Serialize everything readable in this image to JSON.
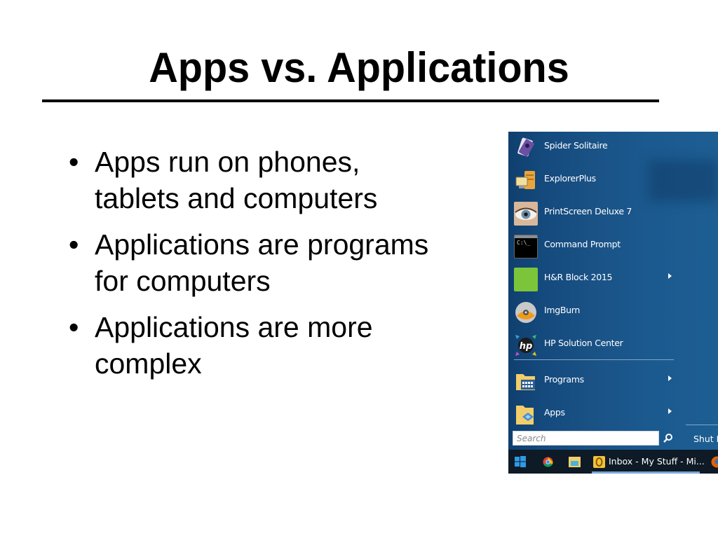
{
  "slide": {
    "title": "Apps vs. Applications",
    "bullet_glyph": "•",
    "bullets": [
      {
        "line1": "Apps run on phones,",
        "line2": "tablets and computers"
      },
      {
        "line1": "Applications are programs",
        "line2": "for computers"
      },
      {
        "line1": "Applications are more",
        "line2": "complex"
      }
    ]
  },
  "start_menu": {
    "items": [
      {
        "label": "Spider Solitaire",
        "icon": "spider-solitaire-icon",
        "submenu": false
      },
      {
        "label": "ExplorerPlus",
        "icon": "explorerplus-icon",
        "submenu": false
      },
      {
        "label": "PrintScreen Deluxe 7",
        "icon": "eye-icon",
        "submenu": false
      },
      {
        "label": "Command Prompt",
        "icon": "command-prompt-icon",
        "submenu": false
      },
      {
        "label": "H&R Block 2015",
        "icon": "hr-block-icon",
        "submenu": true
      },
      {
        "label": "ImgBurn",
        "icon": "imgburn-disc-icon",
        "submenu": false
      },
      {
        "label": "HP Solution Center",
        "icon": "hp-logo-icon",
        "submenu": false
      }
    ],
    "bottom_items": [
      {
        "label": "Programs",
        "icon": "programs-folder-icon",
        "submenu": true
      },
      {
        "label": "Apps",
        "icon": "apps-folder-icon",
        "submenu": true
      }
    ],
    "search_placeholder": "Search",
    "shutdown_label": "Shut D",
    "cmd_icon_text": "C:\\_"
  },
  "taskbar": {
    "window_label": "Inbox - My Stuff - Mi...",
    "buttons": [
      "windows-start-icon",
      "chrome-icon",
      "file-explorer-icon",
      "outlook-icon",
      "firefox-icon"
    ]
  },
  "colors": {
    "menu_bg": "#1a5286",
    "taskbar_bg": "#0e1a26",
    "hr_block_green": "#7cc53a",
    "windows_blue": "#2f9ae8"
  }
}
